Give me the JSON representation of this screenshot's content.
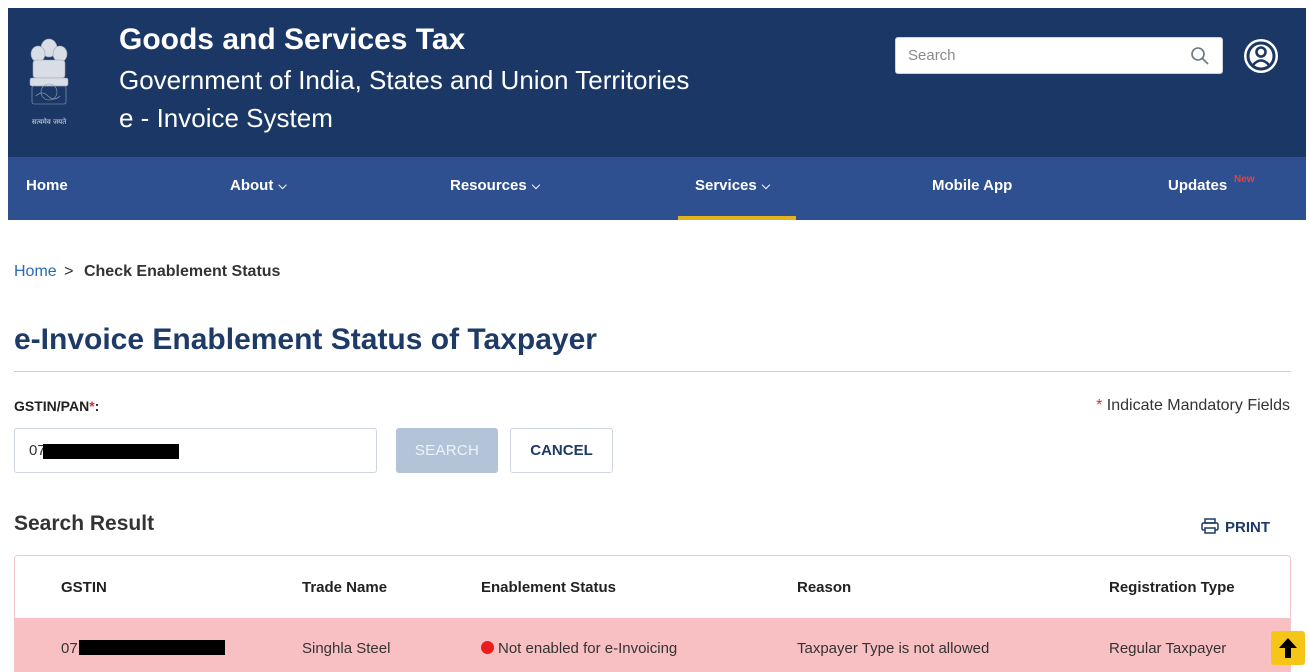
{
  "header": {
    "emblem_caption": "सत्यमेव जयते",
    "title": "Goods and Services Tax",
    "subtitle": "Government of India, States and Union Territories",
    "system": "e - Invoice System",
    "search_placeholder": "Search",
    "colors": {
      "background": "#1b3766",
      "text": "#ffffff"
    }
  },
  "nav": {
    "items": [
      {
        "label": "Home",
        "has_dropdown": false
      },
      {
        "label": "About",
        "has_dropdown": true
      },
      {
        "label": "Resources",
        "has_dropdown": true
      },
      {
        "label": "Services",
        "has_dropdown": true,
        "active": true
      },
      {
        "label": "Mobile App",
        "has_dropdown": false
      },
      {
        "label": "Updates",
        "has_dropdown": false,
        "badge": "New"
      }
    ],
    "colors": {
      "background": "#2e5090",
      "active_underline": "#e3b31b",
      "badge": "#e8413a"
    }
  },
  "breadcrumb": {
    "home": "Home",
    "separator": ">",
    "current": "Check Enablement Status"
  },
  "page": {
    "title": "e-Invoice Enablement Status of Taxpayer",
    "title_color": "#1e3a66"
  },
  "form": {
    "label": "GSTIN/PAN",
    "required_mark": "*",
    "label_suffix": ":",
    "mandatory_note_star": "*",
    "mandatory_note": "Indicate Mandatory Fields",
    "gstin_value": "07",
    "search_button": "SEARCH",
    "cancel_button": "CANCEL"
  },
  "results": {
    "heading": "Search Result",
    "print_label": "PRINT",
    "columns": [
      "GSTIN",
      "Trade Name",
      "Enablement Status",
      "Reason",
      "Registration Type"
    ],
    "rows": [
      {
        "gstin": "07",
        "trade_name": "Singhla Steel",
        "status": "Not enabled for e-Invoicing",
        "reason": "Taxpayer Type is not allowed",
        "registration_type": "Regular Taxpayer"
      }
    ],
    "colors": {
      "row_background": "#f9c0c3",
      "status_dot": "#ea1c1c",
      "border": "#f3c7c7"
    }
  },
  "icons": {
    "search": "search-icon",
    "user": "user-circle-icon",
    "print": "printer-icon",
    "scroll_top": "arrow-up-icon",
    "emblem": "national-emblem-icon"
  },
  "scroll_top_color": "#f5c518"
}
